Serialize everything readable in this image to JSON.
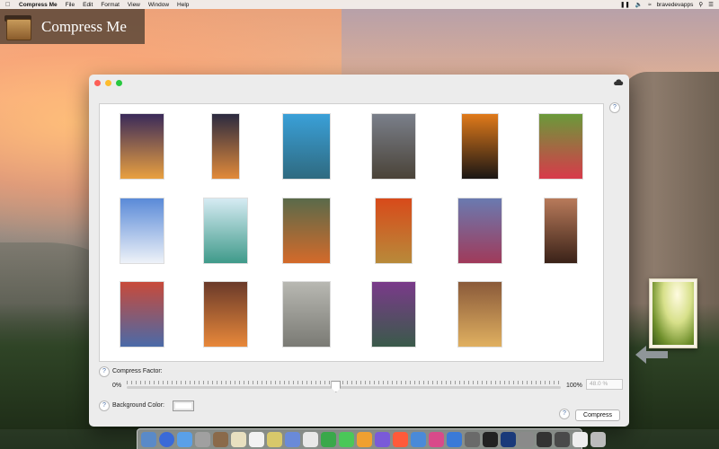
{
  "menubar": {
    "apple": "",
    "app_name": "Compress Me",
    "items": [
      "File",
      "Edit",
      "Format",
      "View",
      "Window",
      "Help"
    ],
    "user": "bravedevapps"
  },
  "banner": {
    "title": "Compress Me"
  },
  "window": {
    "help_glyph": "?",
    "compress_factor_label": "Compress Factor:",
    "min_label": "0%",
    "max_label": "100%",
    "factor_value": "48.0 %",
    "slider_fraction": 0.48,
    "background_color_label": "Background Color:",
    "background_color": "#ffffff",
    "compress_button": "Compress"
  },
  "thumbnails": [
    {
      "name": "palm-sunset",
      "c1": "#3a2a5a",
      "c2": "#e9a040"
    },
    {
      "name": "sea-sunset",
      "c1": "#2b2a40",
      "c2": "#e28a3a"
    },
    {
      "name": "reef",
      "c1": "#3aa0d8",
      "c2": "#2f6a80"
    },
    {
      "name": "moon-field",
      "c1": "#7a7f8a",
      "c2": "#4a4338"
    },
    {
      "name": "orange-moon",
      "c1": "#e07a1a",
      "c2": "#1a1614"
    },
    {
      "name": "tulips",
      "c1": "#6a9a3a",
      "c2": "#d83a4a"
    },
    {
      "name": "snow-beach",
      "c1": "#5a8ad8",
      "c2": "#eef2f8"
    },
    {
      "name": "lagoon",
      "c1": "#d6ebf3",
      "c2": "#3f9a8a"
    },
    {
      "name": "waterfall",
      "c1": "#5a6a4a",
      "c2": "#d46a2a"
    },
    {
      "name": "savanna-sunset",
      "c1": "#d84a1a",
      "c2": "#b88a3a"
    },
    {
      "name": "colorful-stones",
      "c1": "#6a7ab0",
      "c2": "#a03a5a"
    },
    {
      "name": "canyon",
      "c1": "#b87a5a",
      "c2": "#3a2218"
    },
    {
      "name": "fuji",
      "c1": "#c84a3a",
      "c2": "#4a6aa8"
    },
    {
      "name": "antelope-cave",
      "c1": "#6a3a2a",
      "c2": "#e8883a"
    },
    {
      "name": "pebbles",
      "c1": "#b8b8b2",
      "c2": "#7a7a74"
    },
    {
      "name": "lotus-pond",
      "c1": "#7a3a8a",
      "c2": "#3a5a4a"
    },
    {
      "name": "slot-canyon",
      "c1": "#8a5a3a",
      "c2": "#e0b060"
    }
  ],
  "dock_colors": [
    "#5a8ac8",
    "#3a6ad8",
    "#5aa0e8",
    "#a0a0a0",
    "#8a6a4a",
    "#e8e0c0",
    "#f2f2f2",
    "#d8c86a",
    "#6a8ad8",
    "#e8e8e8",
    "#3aa84a",
    "#4ac858",
    "#f0a030",
    "#7a5ad8",
    "#ff5a3a",
    "#4a8ad8",
    "#d84a8a",
    "#3a7ad8",
    "#6a6a6a",
    "#222222",
    "#1a3a7a",
    "#8a8a8a",
    "#333333",
    "#4a4a4a",
    "#eeeeee",
    "#bbbbbb"
  ]
}
